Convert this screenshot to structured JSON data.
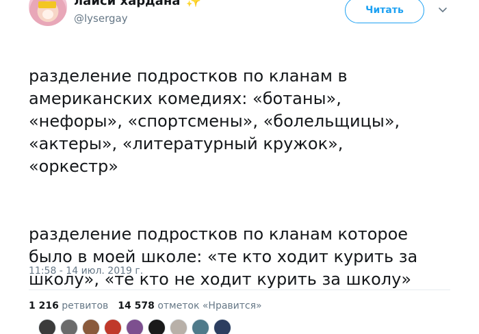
{
  "author": {
    "display_name": "лайси хардана",
    "name_emoji": "✨",
    "handle": "@lysergay"
  },
  "follow_button": {
    "label": "Читать"
  },
  "tweet": {
    "paragraph1": "разделение подростков по кланам в\nамериканских комедиях: «ботаны»,\n«нефоры», «спортсмены», «болельщицы»,\n«актеры», «литературный кружок»,\n«оркестр»",
    "paragraph2": "разделение подростков по кланам которое\nбыло в моей школе: «те кто ходит курить за\nшколу», «те кто не ходит курить за школу»",
    "timestamp": "11:58 - 14 июл. 2019 г."
  },
  "stats": {
    "retweet_count": "1 216",
    "retweet_label": "ретвитов",
    "like_count": "14 578",
    "like_label": "отметок «Нравится»"
  },
  "colors": {
    "accent": "#1da1f2",
    "secondary_text": "#657786",
    "primary_text": "#14171a",
    "divider": "#e6ecf0"
  },
  "likers": [
    {
      "name": "liker-avatar",
      "color": "#3b3b3b"
    },
    {
      "name": "liker-avatar",
      "color": "#6b6b6b"
    },
    {
      "name": "liker-avatar",
      "color": "#8a5a3c"
    },
    {
      "name": "liker-avatar",
      "color": "#c0392b"
    },
    {
      "name": "liker-avatar",
      "color": "#7d4f8f"
    },
    {
      "name": "liker-avatar",
      "color": "#1a1a1a"
    },
    {
      "name": "liker-avatar",
      "color": "#b8b0a8"
    },
    {
      "name": "liker-avatar",
      "color": "#4f7a8a"
    },
    {
      "name": "liker-avatar",
      "color": "#2c3e60"
    }
  ]
}
